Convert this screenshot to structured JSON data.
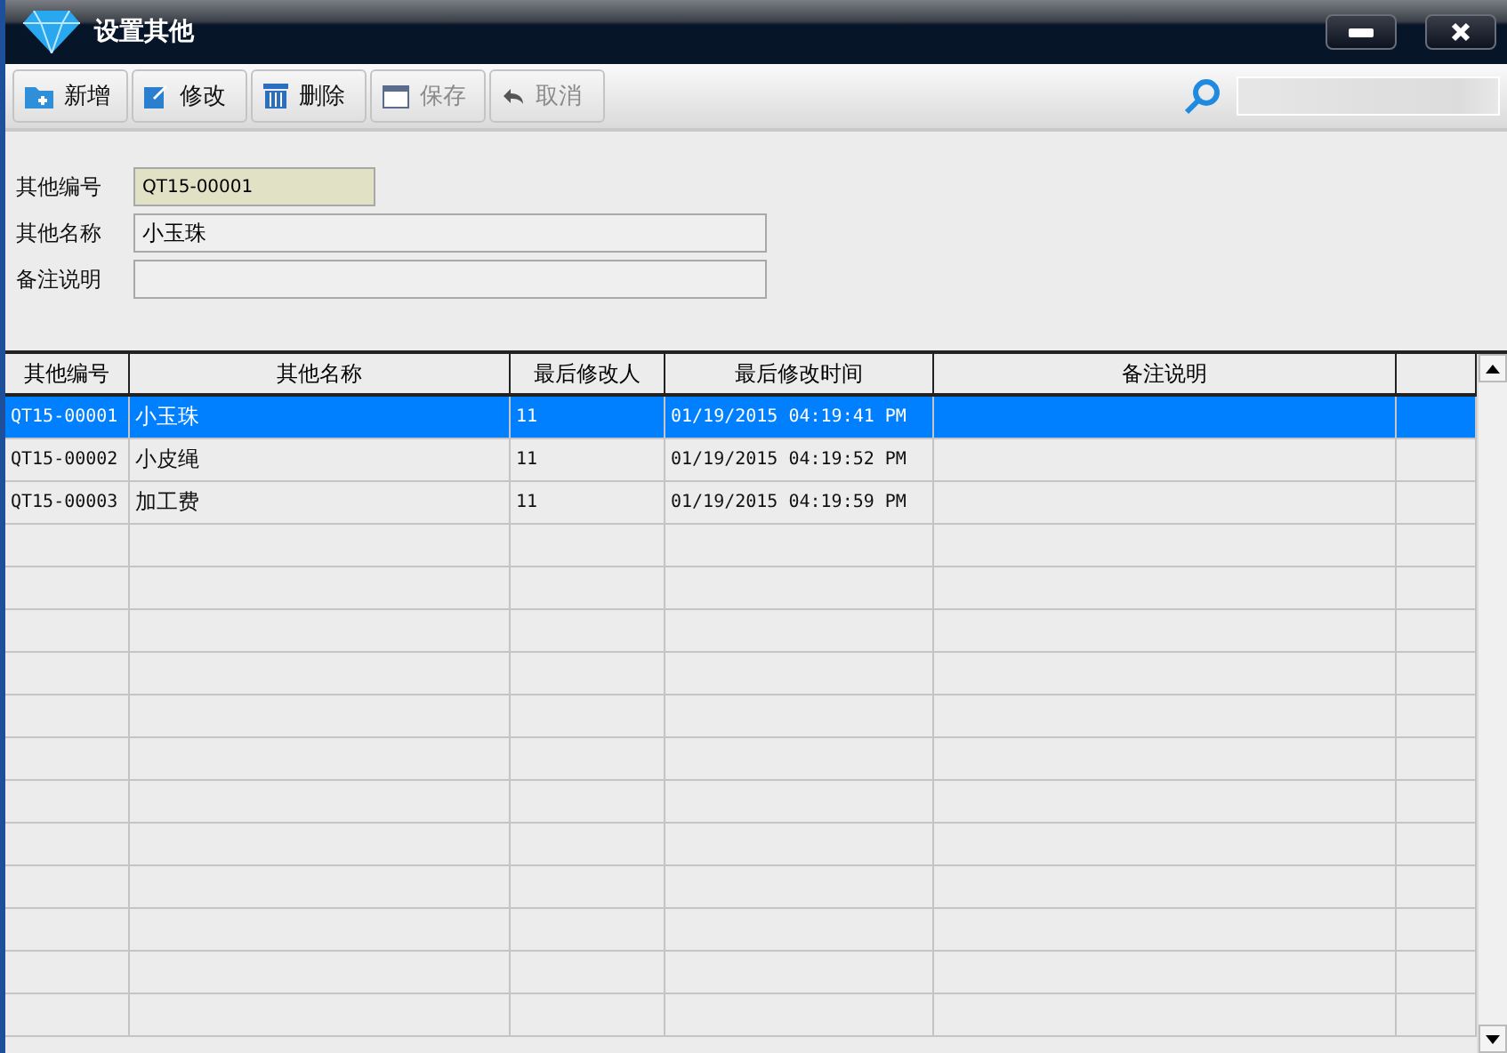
{
  "window": {
    "title": "设置其他"
  },
  "toolbar": [
    {
      "label": "新增",
      "kind": "add",
      "disabled": false
    },
    {
      "label": "修改",
      "kind": "edit",
      "disabled": false
    },
    {
      "label": "删除",
      "kind": "delete",
      "disabled": false
    },
    {
      "label": "保存",
      "kind": "save",
      "disabled": true
    },
    {
      "label": "取消",
      "kind": "undo",
      "disabled": true
    }
  ],
  "form": [
    {
      "label": "其他编号",
      "value": "QT15-00001",
      "kind": "code"
    },
    {
      "label": "其他名称",
      "value": "小玉珠",
      "kind": "text"
    },
    {
      "label": "备注说明",
      "kind": "text"
    }
  ],
  "table": {
    "columns": [
      "其他编号",
      "其他名称",
      "最后修改人",
      "最后修改时间",
      "备注说明"
    ],
    "rows": [
      {
        "cells": [
          "QT15-00001",
          "小玉珠",
          "11",
          "01/19/2015 04:19:41 PM"
        ],
        "selected": true
      },
      {
        "cells": [
          "QT15-00002",
          "小皮绳",
          "11",
          "01/19/2015 04:19:52 PM"
        ],
        "selected": false
      },
      {
        "cells": [
          "QT15-00003",
          "加工费",
          "11",
          "01/19/2015 04:19:59 PM"
        ],
        "selected": false
      }
    ]
  }
}
